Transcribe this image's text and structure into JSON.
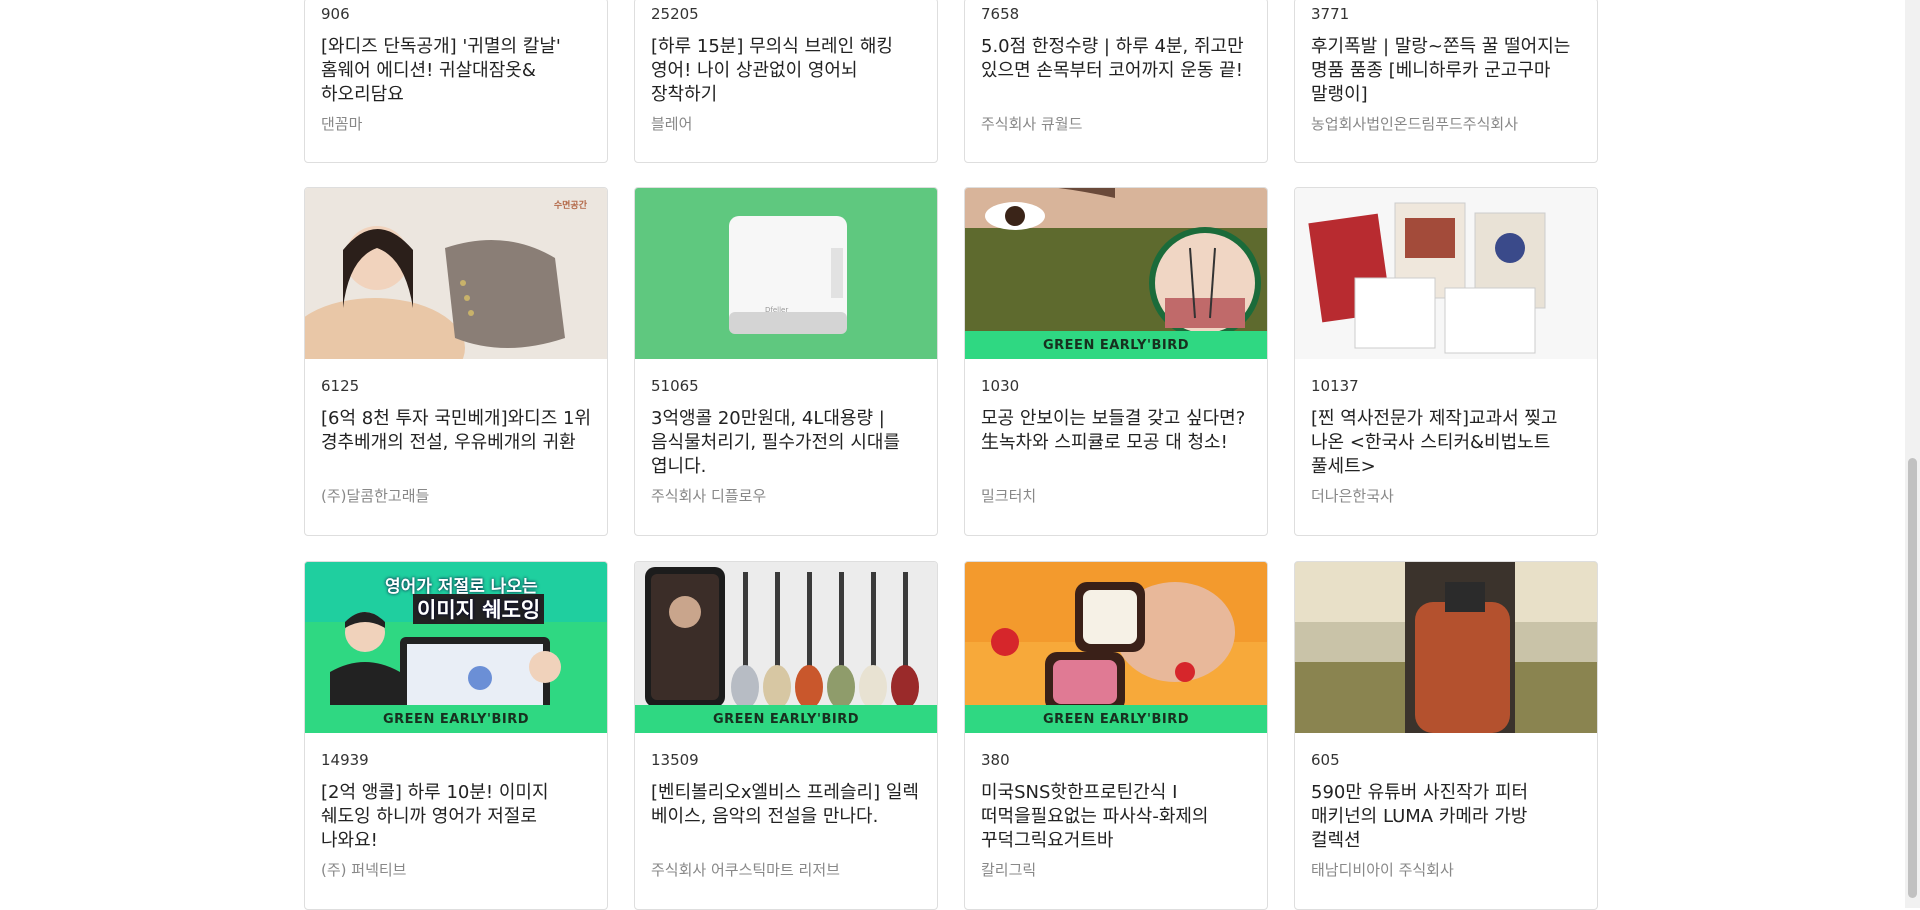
{
  "colors": {
    "banner": "#2fd882",
    "count": "#333333",
    "maker": "#888888"
  },
  "rows": [
    [
      {
        "count": "906",
        "title": "[와디즈 단독공개] '귀멸의 칼날' 홈웨어 에디션! 귀살대잠옷&하오리담요",
        "maker": "댄꼼마"
      },
      {
        "count": "25205",
        "title": "[하루 15분] 무의식 브레인 해킹 영어! 나이 상관없이 영어뇌 장착하기",
        "maker": "블레어"
      },
      {
        "count": "7658",
        "title": "5.0점 한정수량 | 하루 4분, 쥐고만 있으면 손목부터 코어까지 운동 끝!",
        "maker": "주식회사 큐월드"
      },
      {
        "count": "3771",
        "title": "후기폭발 | 말랑~쫀득 꿀 떨어지는 명품 품종 [베니하루카 군고구마 말랭이]",
        "maker": "농업회사법인온드림푸드주식회사"
      }
    ],
    [
      {
        "count": "6125",
        "title": "[6억 8천 투자 국민베개]와디즈 1위 경추베개의 전설, 우유베개의 귀환",
        "maker": "(주)달콤한고래들",
        "image": "pillow-photo",
        "image_text": "수면공간"
      },
      {
        "count": "51065",
        "title": "3억앵콜 20만원대, 4L대용량 | 음식물처리기, 필수가전의 시대를 엽니다.",
        "maker": "주식회사 디플로우",
        "image": "food-waste-processor-photo",
        "image_text": "Dfeller"
      },
      {
        "count": "1030",
        "title": "모공 안보이는 보들결 갖고 싶다면? 生녹차와 스피큘로 모공 대 청소!",
        "maker": "밀크터치",
        "image": "green-mask-photo",
        "banner": "GREEN EARLY'BIRD"
      },
      {
        "count": "10137",
        "title": "[찐 역사전문가 제작]교과서 찢고 나온 <한국사 스티커&비법노트 풀세트>",
        "maker": "더나은한국사",
        "image": "history-sticker-photo"
      }
    ],
    [
      {
        "count": "14939",
        "title": "[2억 앵콜] 하루 10분! 이미지 쉐도잉 하니까 영어가 저절로 나와요!",
        "maker": "(주) 퍼넥티브",
        "image": "english-shadowing-photo",
        "image_text_1": "영어가 저절로 나오는",
        "image_text_2": "이미지 쉐도잉",
        "banner": "GREEN EARLY'BIRD"
      },
      {
        "count": "13509",
        "title": "[벤티볼리오x엘비스 프레슬리] 일렉 베이스, 음악의 전설을 만나다.",
        "maker": "주식회사 어쿠스틱마트 리저브",
        "image": "bass-guitars-photo",
        "banner": "GREEN EARLY'BIRD"
      },
      {
        "count": "380",
        "title": "미국SNS핫한프로틴간식 I 떠먹을필요없는 파사삭-화제의 꾸덕그릭요거트바",
        "maker": "칼리그릭",
        "image": "yogurt-bar-photo",
        "banner": "GREEN EARLY'BIRD"
      },
      {
        "count": "605",
        "title": "590만 유튜버 사진작가 피터 매키넌의 LUMA 카메라 가방 컬렉션",
        "maker": "태남디비아이 주식회사",
        "image": "camera-bag-photo"
      }
    ]
  ]
}
